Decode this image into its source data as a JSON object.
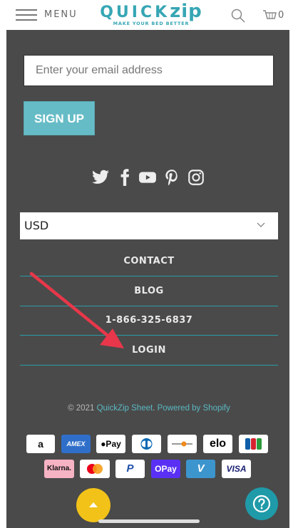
{
  "header": {
    "menu_label": "MENU",
    "logo_word": "QUICK",
    "logo_word_bold": "zip",
    "logo_tagline": "MAKE YOUR BED BETTER",
    "cart_count": "0"
  },
  "newsletter": {
    "email_placeholder": "Enter your email address",
    "signup_label": "SIGN UP"
  },
  "social": [
    "twitter-icon",
    "facebook-icon",
    "youtube-icon",
    "pinterest-icon",
    "instagram-icon"
  ],
  "currency": {
    "selected": "USD"
  },
  "footer_links": [
    "CONTACT",
    "BLOG",
    "1-866-325-6837",
    "LOGIN"
  ],
  "copyright": {
    "prefix": "© 2021 ",
    "brand": "QuickZip Sheet",
    "separator": ". ",
    "powered": "Powered by Shopify"
  },
  "payment_methods": [
    "Amazon",
    "AMEX",
    "Apple Pay",
    "Diners Club",
    "Discover",
    "elo",
    "JCB",
    "Klarna.",
    "Mastercard",
    "PayPal",
    "OPay",
    "Venmo",
    "VISA"
  ],
  "colors": {
    "brand": "#36a6b4",
    "panel": "#4a4a4a",
    "signup": "#66bcc6",
    "arrow": "#e8374a",
    "scroll_top": "#f2c219"
  }
}
